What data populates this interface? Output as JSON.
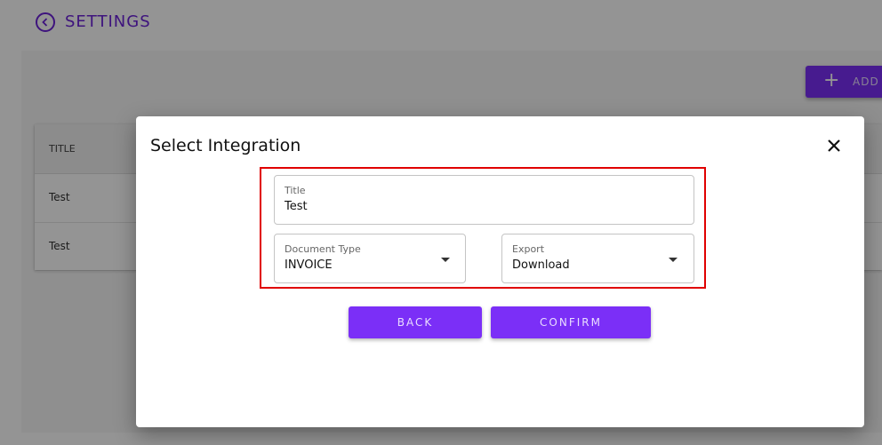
{
  "header": {
    "title": "SETTINGS",
    "back_icon": "chevron-left-circle-icon"
  },
  "toolbar": {
    "add_label": "ADD I"
  },
  "table": {
    "columns": [
      "TITLE"
    ],
    "rows": [
      {
        "title": "Test"
      },
      {
        "title": "Test"
      }
    ]
  },
  "dialog": {
    "title": "Select Integration",
    "close_icon": "close-icon",
    "fields": {
      "title": {
        "label": "Title",
        "value": "Test"
      },
      "document_type": {
        "label": "Document Type",
        "value": "INVOICE"
      },
      "export": {
        "label": "Export",
        "value": "Download"
      }
    },
    "buttons": {
      "back": "BACK",
      "confirm": "CONFIRM"
    }
  },
  "colors": {
    "accent": "#7b2ff7",
    "highlight": "#e00000"
  }
}
